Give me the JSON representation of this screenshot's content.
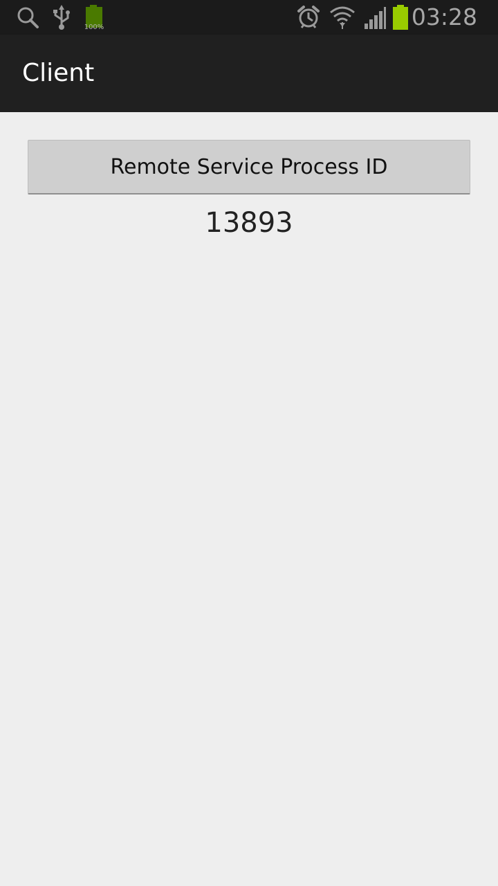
{
  "status_bar": {
    "icons": [
      "search-icon",
      "usb-icon",
      "battery-notification-icon",
      "alarm-icon",
      "wifi-icon",
      "signal-icon",
      "battery-icon"
    ],
    "battery_notification_text": "100%",
    "time": "03:28",
    "battery_color": "#99cc00"
  },
  "action_bar": {
    "title": "Client"
  },
  "main": {
    "button_label": "Remote Service Process ID",
    "process_id": "13893"
  }
}
